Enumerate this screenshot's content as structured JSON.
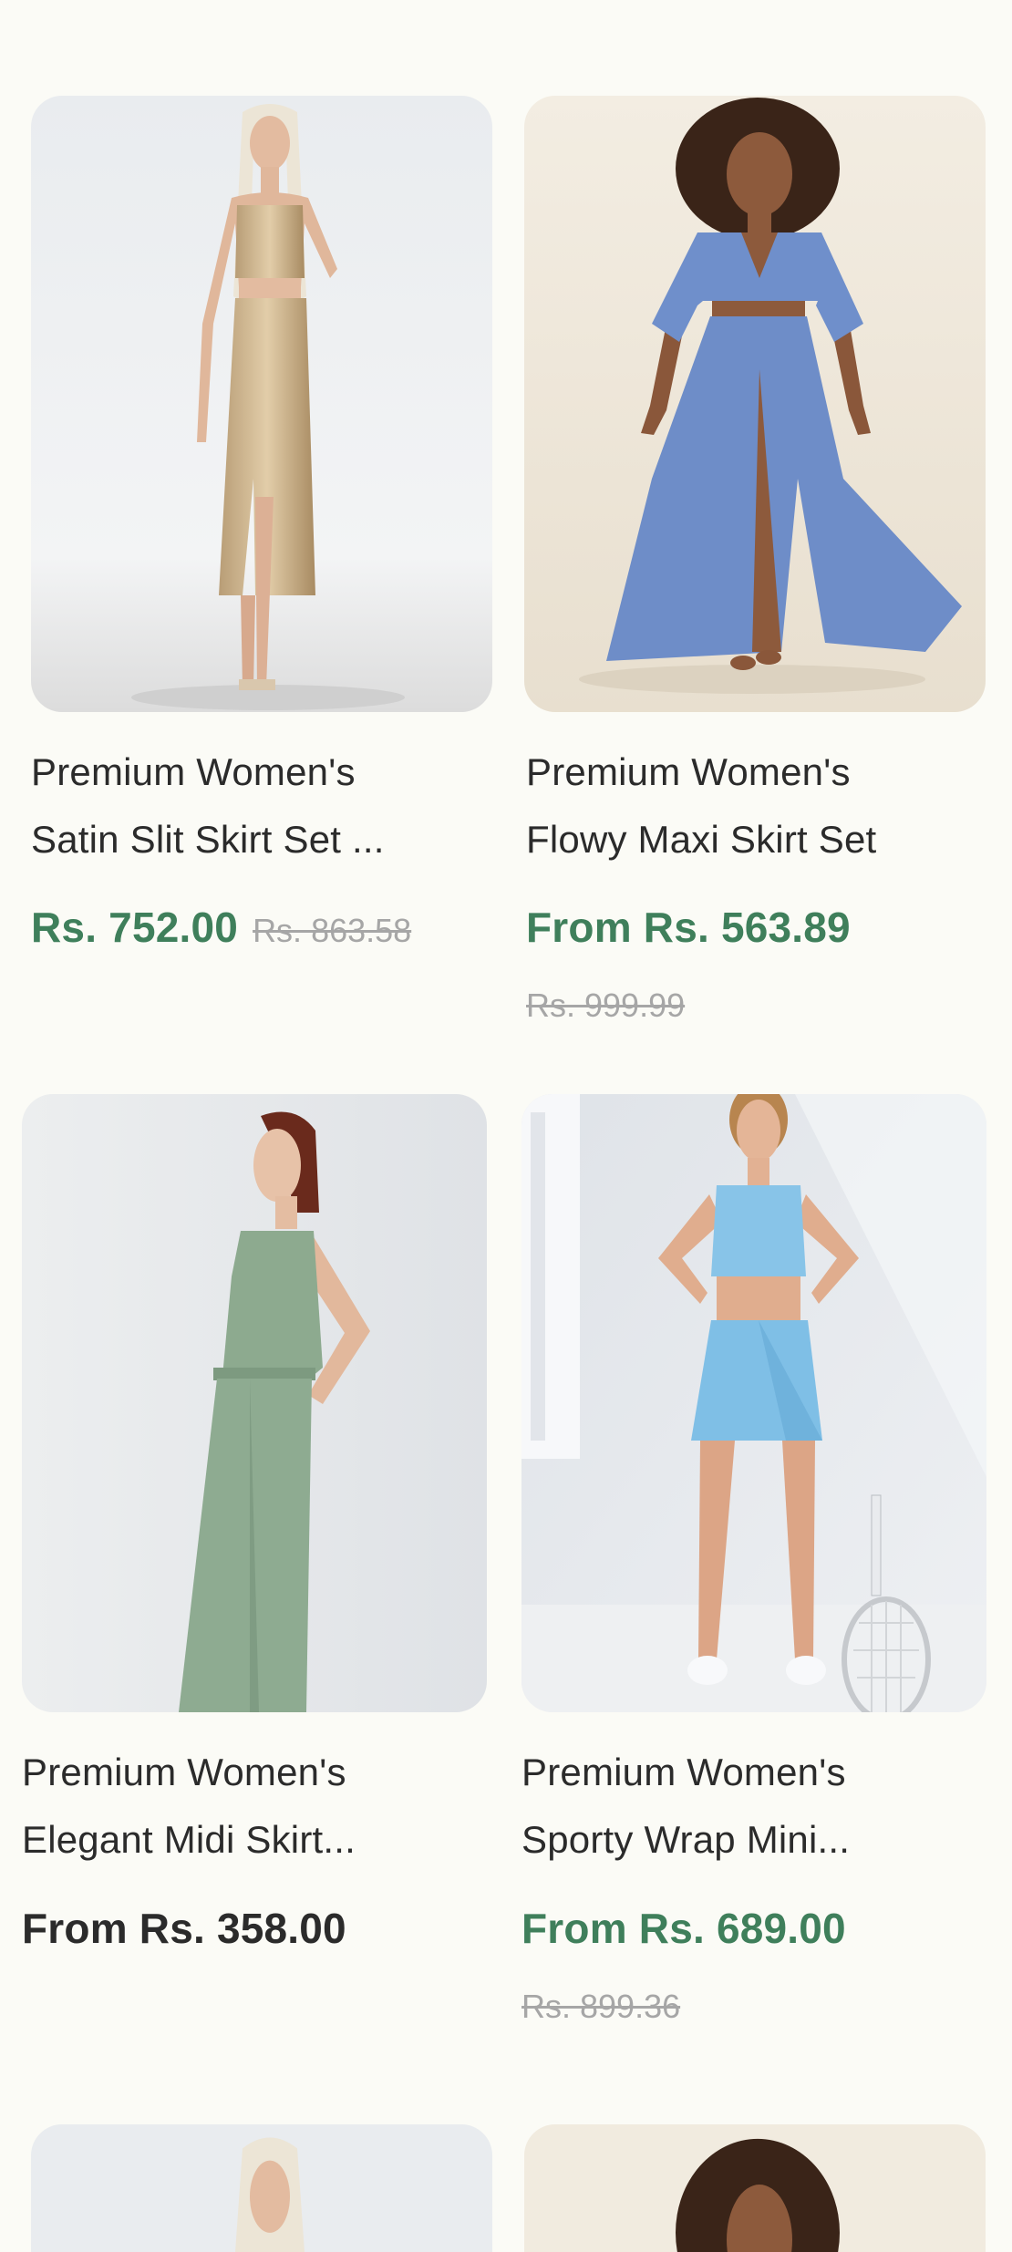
{
  "colors": {
    "background": "#fbfbf6",
    "sale_price": "#3f7f5b",
    "regular_price": "#2b2b2b",
    "compare_price": "#a6a6a6"
  },
  "products": [
    {
      "title_line1": "Premium Women's",
      "title_line2": "Satin Slit Skirt Set ...",
      "price": "Rs. 752.00",
      "compare_price": "Rs. 863.58",
      "on_sale": true
    },
    {
      "title_line1": "Premium Women's",
      "title_line2": "Flowy Maxi Skirt Set",
      "price": "From Rs. 563.89",
      "compare_price": "Rs. 999.99",
      "on_sale": true
    },
    {
      "title_line1": "Premium Women's",
      "title_line2": "Elegant Midi Skirt...",
      "price": "From Rs. 358.00",
      "on_sale": false
    },
    {
      "title_line1": "Premium Women's",
      "title_line2": "Sporty Wrap Mini...",
      "price": "From Rs. 689.00",
      "compare_price": "Rs. 899.36",
      "on_sale": true
    }
  ]
}
